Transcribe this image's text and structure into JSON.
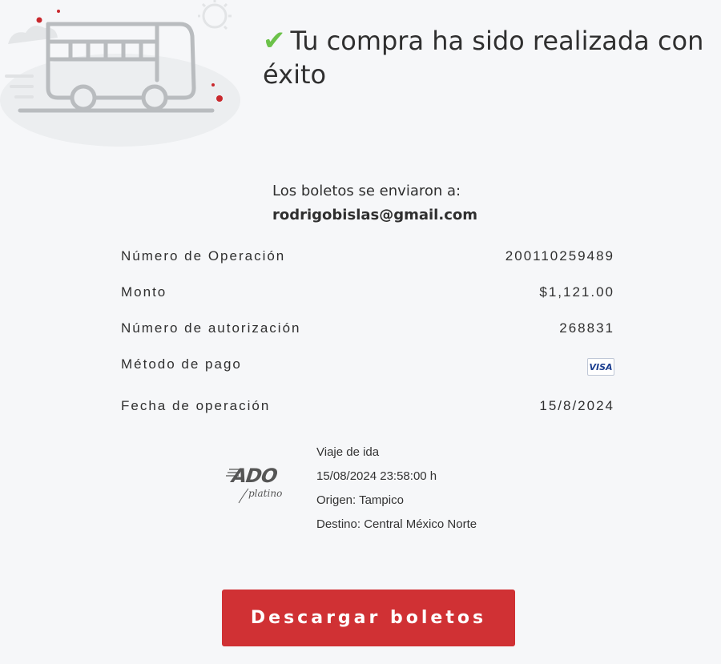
{
  "header": {
    "check_icon": "✔",
    "title": "Tu compra ha sido realizada con éxito"
  },
  "sent": {
    "label": "Los boletos se enviaron a:",
    "email": "rodrigobislas@gmail.com"
  },
  "details": {
    "operation_number": {
      "label": "Número de Operación",
      "value": "200110259489"
    },
    "amount": {
      "label": "Monto",
      "value": "$1,121.00"
    },
    "authorization": {
      "label": "Número de autorización",
      "value": "268831"
    },
    "payment_method": {
      "label": "Método de pago",
      "value": "VISA",
      "icon": "visa-card-icon"
    },
    "operation_date": {
      "label": "Fecha de operación",
      "value": "15/8/2024"
    }
  },
  "trip": {
    "logo_text": "ADO",
    "logo_subtext": "platino",
    "type": "Viaje de ida",
    "datetime": "15/08/2024 23:58:00 h",
    "origin": "Origen: Tampico",
    "destination": "Destino: Central México Norte"
  },
  "actions": {
    "download_label": "Descargar boletos"
  },
  "colors": {
    "background": "#f6f7f9",
    "check": "#6cc24a",
    "button": "#d03134",
    "illustration": "#b9bcbf",
    "accent_dot": "#c9282d"
  }
}
